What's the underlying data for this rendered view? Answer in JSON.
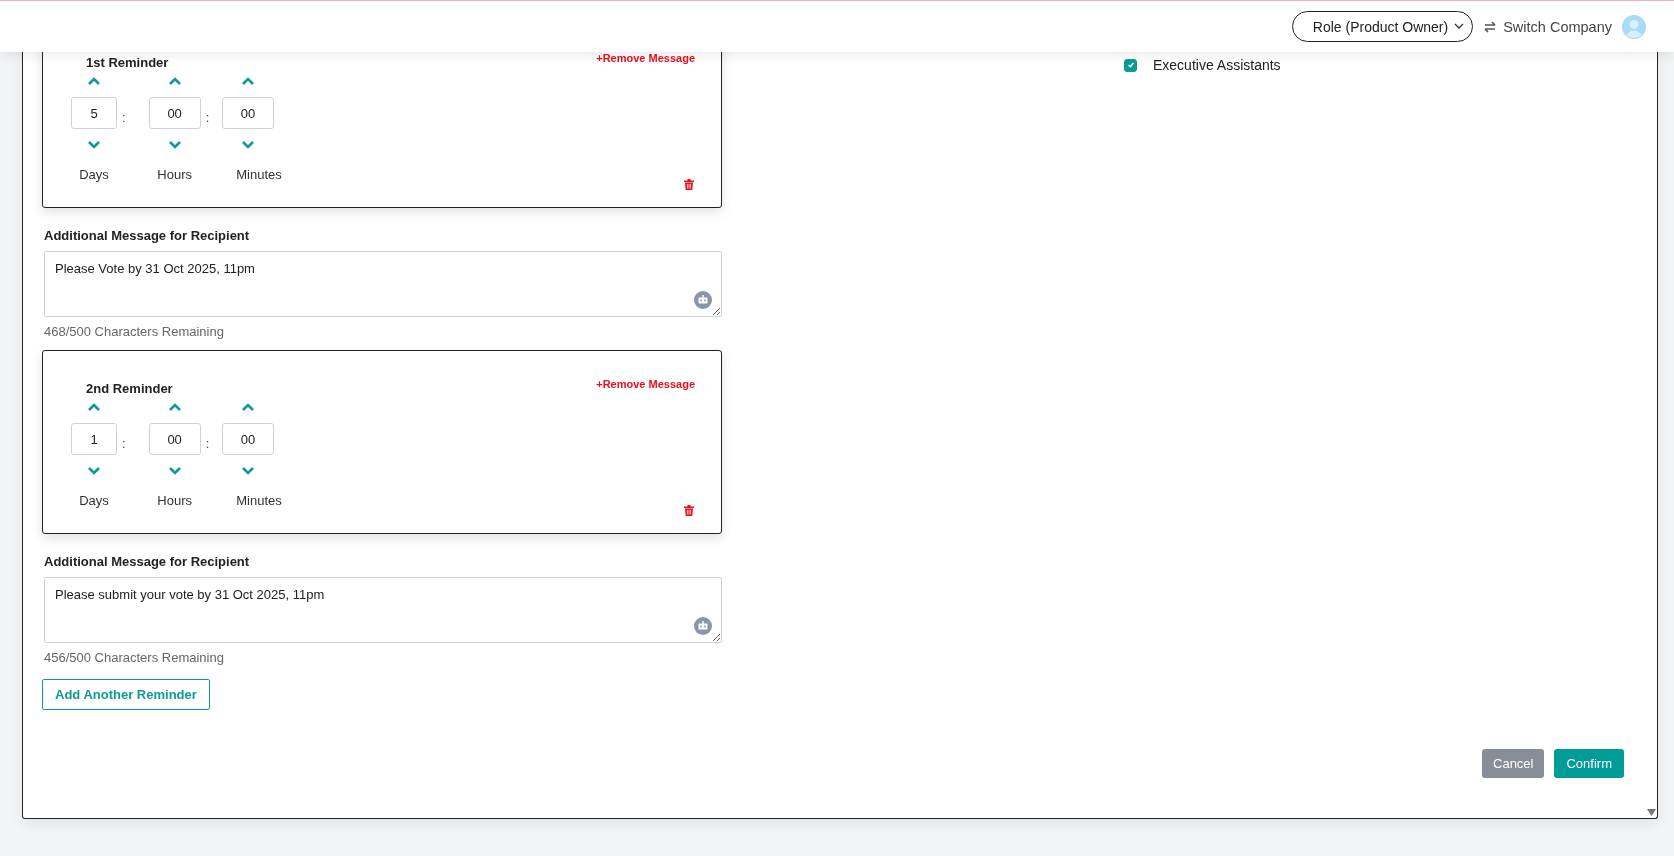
{
  "header": {
    "role_menu": "Role (Product Owner)",
    "switch_company": "Switch Company"
  },
  "recipients": [
    {
      "label": "Executive Assistants",
      "checked": true
    }
  ],
  "reminders": [
    {
      "title": "1st Reminder",
      "remove": "+Remove Message",
      "fields": [
        {
          "value": "5",
          "label": "Days"
        },
        {
          "value": "00",
          "label": "Hours"
        },
        {
          "value": "00",
          "label": "Minutes"
        }
      ],
      "separator": ":",
      "message_label": "Additional Message for Recipient",
      "message": "Please Vote by 31 Oct 2025, 11pm",
      "counter": "468/500 Characters Remaining"
    },
    {
      "title": "2nd Reminder",
      "remove": "+Remove Message",
      "fields": [
        {
          "value": "1",
          "label": "Days"
        },
        {
          "value": "00",
          "label": "Hours"
        },
        {
          "value": "00",
          "label": "Minutes"
        }
      ],
      "separator": ":",
      "message_label": "Additional Message for Recipient",
      "message": "Please submit your vote by 31 Oct 2025, 11pm",
      "counter": "456/500 Characters Remaining"
    }
  ],
  "add_reminder": "Add Another Reminder",
  "buttons": [
    {
      "label": "Cancel",
      "kind": "secondary"
    },
    {
      "label": "Confirm",
      "kind": "primary"
    }
  ]
}
